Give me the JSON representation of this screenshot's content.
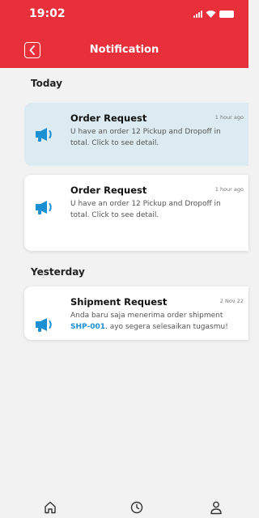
{
  "status_bar": {
    "time": "19:02"
  },
  "header": {
    "title": "Notification"
  },
  "sections": {
    "today": "Today",
    "yesterday": "Yesterday"
  },
  "notifications": [
    {
      "title": "Order Request",
      "time": "1 hour ago",
      "body": "U have an order 12 Pickup and Dropoff in total. Click to see detail.",
      "highlighted": true
    },
    {
      "title": "Order Request",
      "time": "1 hour ago",
      "body": "U have an order 12 Pickup and Dropoff in total. Click to see detail.",
      "highlighted": false
    },
    {
      "title": "Shipment Request",
      "time": "2 Nov 22",
      "body_before": "Anda baru saja menerima order shipment ",
      "body_code": "SHP-001",
      "body_after": ". ayo segera selesaikan tugasmu!",
      "highlighted": false
    }
  ],
  "icons": {
    "back": "chevron-left-icon",
    "notification": "megaphone-icon",
    "nav_home": "home-icon",
    "nav_history": "clock-icon",
    "nav_profile": "user-icon"
  },
  "colors": {
    "header": "#e8303a",
    "icon": "#1a8fd1",
    "highlight_card": "#dcebf1",
    "background": "#f2f2f2"
  }
}
